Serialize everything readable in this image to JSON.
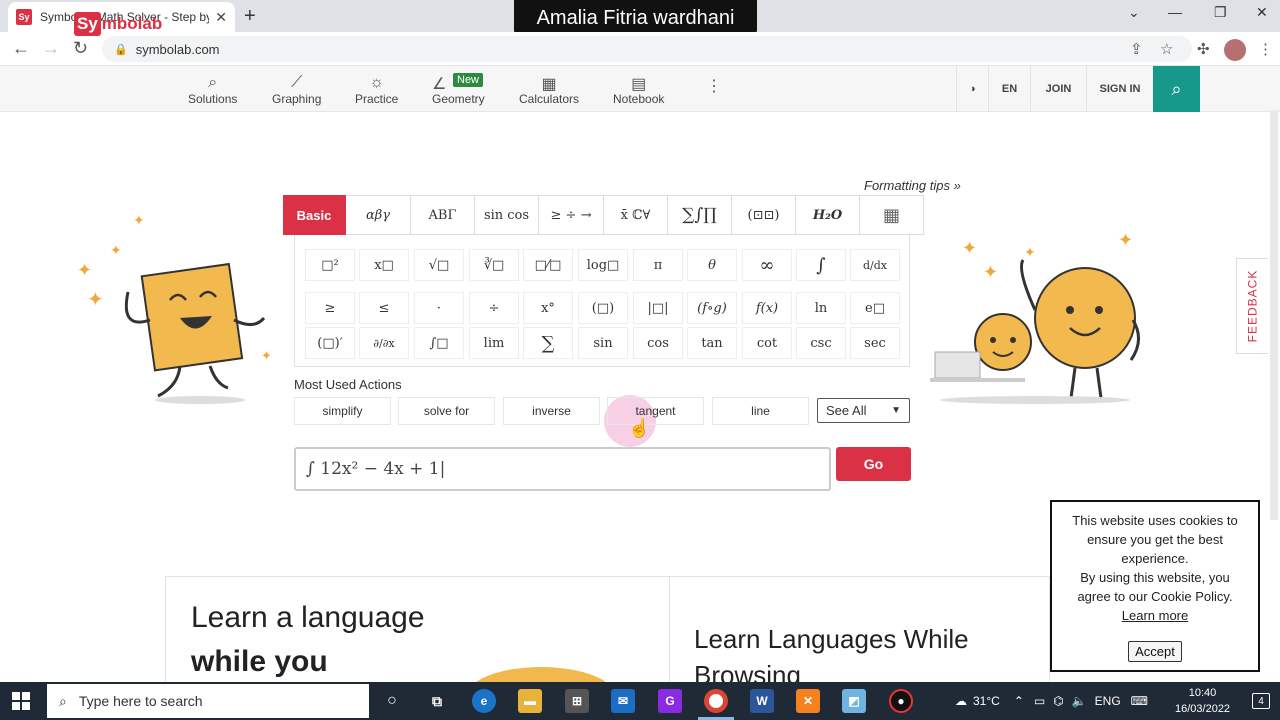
{
  "browser": {
    "tab_title": "Symbolab Math Solver - Step by",
    "tab_favicon": "Sy",
    "url": "symbolab.com",
    "overlay_name": "Amalia Fitria wardhani"
  },
  "header": {
    "logo_prefix": "Sy",
    "logo_rest": "mbolab",
    "nav": [
      {
        "label": "Solutions",
        "icon": "search-icon"
      },
      {
        "label": "Graphing",
        "icon": "chart-icon"
      },
      {
        "label": "Practice",
        "icon": "lightbulb-icon"
      },
      {
        "label": "Geometry",
        "icon": "angle-icon"
      },
      {
        "label": "Calculators",
        "icon": "calculator-icon"
      },
      {
        "label": "Notebook",
        "icon": "notebook-icon"
      }
    ],
    "new_badge": "New",
    "lang": "EN",
    "join": "JOIN",
    "signin": "SIGN IN"
  },
  "keyboard": {
    "formatting_tips": "Formatting tips »",
    "tabs": [
      "Basic",
      "αβγ",
      "ΑΒΓ",
      "sin cos",
      "≥ ÷ →",
      "x̄ ℂ∀",
      "∑∫∏",
      "(⊡⊡)",
      "H₂O",
      "▦"
    ],
    "keys_row1": [
      "□²",
      "x□",
      "√□",
      "∛□",
      "□⁄□",
      "log□",
      "π",
      "θ",
      "∞",
      "∫",
      "d/dx"
    ],
    "keys_row2": [
      "≥",
      "≤",
      "·",
      "÷",
      "x°",
      "(□)",
      "|□|",
      "(f∘g)",
      "f(x)",
      "ln",
      "e□"
    ],
    "keys_row3": [
      "(□)′",
      "∂/∂x",
      "∫□",
      "lim",
      "∑",
      "sin",
      "cos",
      "tan",
      "cot",
      "csc",
      "sec"
    ]
  },
  "actions": {
    "label": "Most Used Actions",
    "buttons": [
      "simplify",
      "solve for",
      "inverse",
      "tangent",
      "line"
    ],
    "see_all": "See All"
  },
  "input": {
    "expression": "∫ 12x² − 4x + 1|",
    "go": "Go"
  },
  "feedback": "FEEDBACK",
  "ads": {
    "left_line1": "Learn a language",
    "left_line2": "while you",
    "right_line1": "Learn Languages While Browsing"
  },
  "cookie": {
    "text1": "This website uses cookies to ensure you get the best experience.",
    "text2": "By using this website, you agree to our Cookie Policy.",
    "link": "Learn more",
    "accept": "Accept"
  },
  "taskbar": {
    "search_placeholder": "Type here to search",
    "temperature": "31°C",
    "lang": "ENG",
    "time": "10:40",
    "date": "16/03/2022",
    "notifications": "4"
  },
  "colors": {
    "brand_red": "#db3146",
    "teal": "#16998b",
    "taskbar": "#1f2a36"
  }
}
